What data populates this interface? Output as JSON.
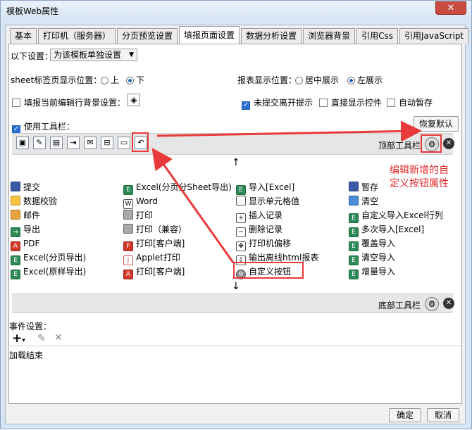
{
  "window": {
    "title": "模板Web属性",
    "close_label": "✕"
  },
  "tabs": [
    "基本",
    "打印机（服务器）",
    "分页预览设置",
    "填报页面设置",
    "数据分析设置",
    "浏览器背景",
    "引用Css",
    "引用JavaScript"
  ],
  "settings": {
    "scope_label": "以下设置：",
    "scope_value": "为该模板单独设置",
    "sheet_label": "sheet标签页显示位置：",
    "sheet_opt_up": "上",
    "sheet_opt_down": "下",
    "report_label": "报表显示位置：",
    "report_opt_center": "居中展示",
    "report_opt_left": "左展示",
    "fill_bg_label": "填报当前编辑行背景设置：",
    "unsubmitted_label": "未提交离开提示",
    "direct_widget_label": "直接显示控件",
    "auto_save_label": "自动暂存",
    "use_toolbar_label": "使用工具栏：",
    "restore_label": "恢复默认"
  },
  "toolbar": {
    "top_label": "顶部工具栏",
    "bottom_label": "底部工具栏"
  },
  "annotation": {
    "text_line1": "编辑新增的自",
    "text_line2": "定义按钮属性",
    "color": "#e02a2a"
  },
  "buttons": [
    [
      "提交",
      "Excel(分页分Sheet导出)",
      "导入[Excel]",
      "暂存"
    ],
    [
      "数据校验",
      "Word",
      "显示单元格值",
      "清空"
    ],
    [
      "邮件",
      "打印",
      "插入记录",
      "自定义导入Excel行列"
    ],
    [
      "导出",
      "打印（兼容）",
      "删除记录",
      "多次导入[Excel]"
    ],
    [
      "PDF",
      "打印[客户端]",
      "打印机偏移",
      "覆盖导入"
    ],
    [
      "Excel(分页导出)",
      "Applet打印",
      "输出离线html报表",
      "清空导入"
    ],
    [
      "Excel(原样导出)",
      "打印[客户端]",
      "自定义按钮",
      "增量导入"
    ]
  ],
  "events": {
    "label": "事件设置：",
    "add_label": "+",
    "item": "加载结束"
  },
  "footer": {
    "ok_label": "确定",
    "cancel_label": "取消"
  }
}
